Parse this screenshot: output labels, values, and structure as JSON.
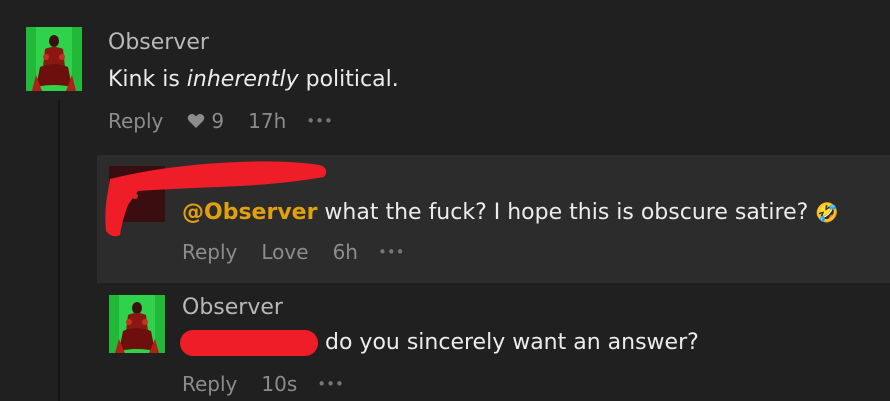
{
  "comments": [
    {
      "author": "Observer",
      "body_pre": "Kink is ",
      "body_em": "inherently",
      "body_post": " political.",
      "reply_label": "Reply",
      "likes": "9",
      "time": "17h",
      "more": "•••",
      "icons": [
        "heart-icon",
        "more-icon"
      ]
    },
    {
      "author": "",
      "mention": "@Observer",
      "body": " what the fuck? I hope this is obscure satire?",
      "emoji": "🤣",
      "reply_label": "Reply",
      "love_label": "Love",
      "time": "6h",
      "more": "•••"
    },
    {
      "author": "Observer",
      "body": "do you sincerely want an answer?",
      "reply_label": "Reply",
      "time": "10s",
      "more": "•••"
    }
  ],
  "colors": {
    "background": "#202020",
    "highlight": "#2c2c2c",
    "mention": "#e0a010",
    "redaction": "#ee1d27",
    "avatar_green": "#2fd24a"
  }
}
